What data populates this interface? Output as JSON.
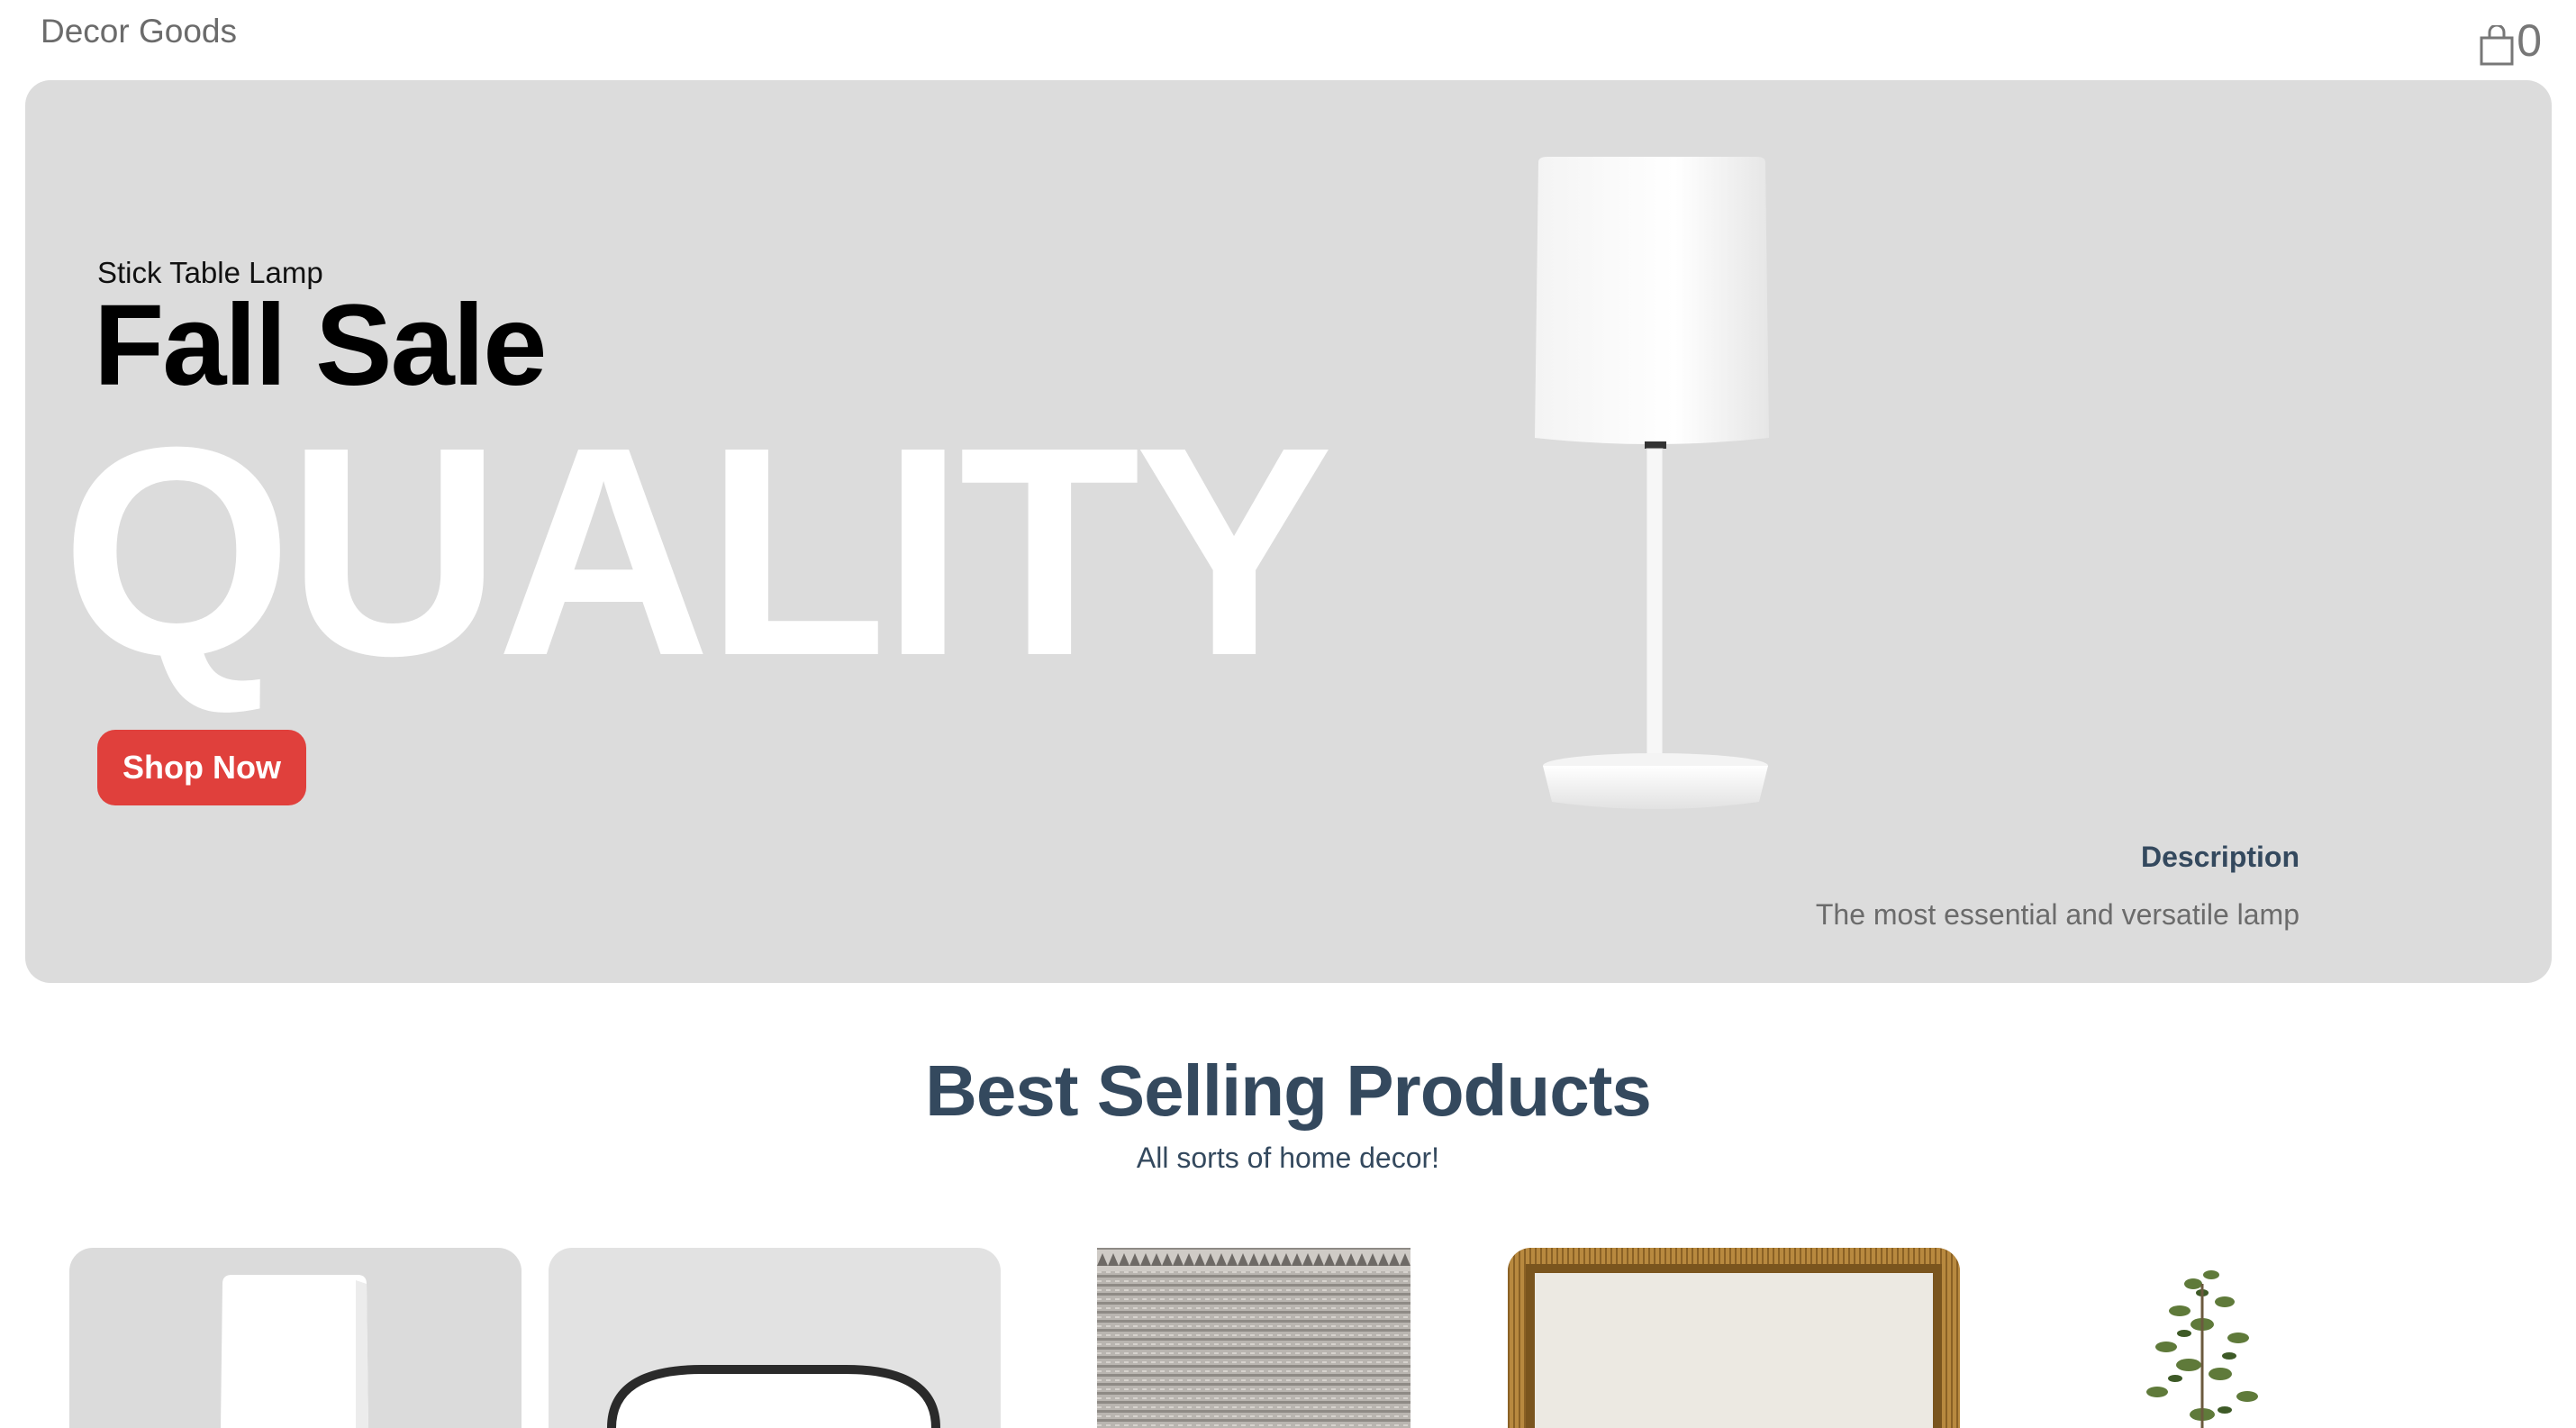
{
  "header": {
    "logo": "Decor Goods",
    "cart_count": "0",
    "cart_icon": "shopping-bag-icon"
  },
  "hero": {
    "product_name": "Stick Table Lamp",
    "title": "Fall Sale",
    "background_word": "QUALITY",
    "cta_label": "Shop Now",
    "description_title": "Description",
    "description_text": "The most essential and versatile lamp",
    "background_color": "#dcdcdc",
    "accent_color": "#e0403c"
  },
  "best_selling": {
    "title": "Best Selling Products",
    "subtitle": "All sorts of home decor!",
    "products": [
      {
        "image": "table-lamp"
      },
      {
        "image": "round-mirror"
      },
      {
        "image": "woven-rug"
      },
      {
        "image": "gold-framed-art"
      },
      {
        "image": "potted-olive-tree"
      }
    ]
  }
}
